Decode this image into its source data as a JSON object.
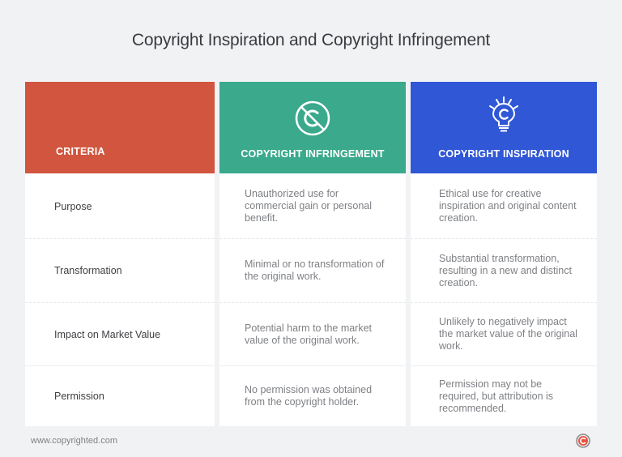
{
  "title": "Copyright Inspiration and Copyright Infringement",
  "colors": {
    "criteria_header": "#d1553f",
    "infringement_header": "#3aa98c",
    "inspiration_header": "#3057d5",
    "background": "#f1f2f4"
  },
  "columns": [
    {
      "label": "CRITERIA",
      "icon": ""
    },
    {
      "label": "COPYRIGHT INFRINGEMENT",
      "icon": "no-copyright-icon"
    },
    {
      "label": "COPYRIGHT INSPIRATION",
      "icon": "lightbulb-copyright-icon"
    }
  ],
  "rows": [
    {
      "criterion": "Purpose",
      "infringement": "Unauthorized use for commercial gain or personal benefit.",
      "inspiration": "Ethical use for creative inspiration and original content creation."
    },
    {
      "criterion": "Transformation",
      "infringement": "Minimal or no transformation of the original work.",
      "inspiration": "Substantial transformation, resulting in a new and distinct creation."
    },
    {
      "criterion": "Impact on Market Value",
      "infringement": "Potential harm to the market value of the original work.",
      "inspiration": "Unlikely to negatively impact the market value of the original work."
    },
    {
      "criterion": "Permission",
      "infringement": "No permission was obtained from the copyright holder.",
      "inspiration": "Permission may not be required, but attribution is recommended."
    }
  ],
  "footer": {
    "url": "www.copyrighted.com",
    "logo_icon": "copyrighted-logo-icon"
  }
}
